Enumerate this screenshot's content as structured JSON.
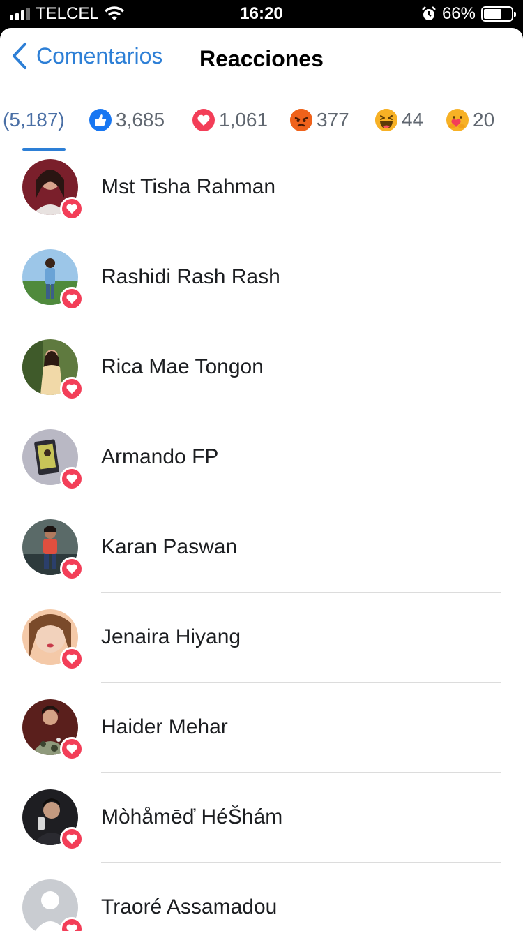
{
  "status_bar": {
    "carrier": "TELCEL",
    "time": "16:20",
    "battery": "66%",
    "battery_level": 0.66
  },
  "nav": {
    "back_label": "Comentarios",
    "title": "Reacciones"
  },
  "tabs": [
    {
      "label": "(5,187)",
      "icon": null
    },
    {
      "label": "3,685",
      "icon": "like-icon"
    },
    {
      "label": "1,061",
      "icon": "love-icon"
    },
    {
      "label": "377",
      "icon": "angry-icon"
    },
    {
      "label": "44",
      "icon": "haha-icon"
    },
    {
      "label": "20",
      "icon": "care-icon"
    }
  ],
  "users": [
    {
      "name": "Mst Tisha Rahman",
      "avatar": "avatar-photo",
      "reaction": "love-icon"
    },
    {
      "name": "Rashidi Rash Rash",
      "avatar": "avatar-photo",
      "reaction": "love-icon"
    },
    {
      "name": "Rica Mae Tongon",
      "avatar": "avatar-photo",
      "reaction": "love-icon"
    },
    {
      "name": "Armando FP",
      "avatar": "avatar-photo",
      "reaction": "love-icon"
    },
    {
      "name": "Karan Paswan",
      "avatar": "avatar-photo",
      "reaction": "love-icon"
    },
    {
      "name": "Jenaira Hiyang",
      "avatar": "avatar-photo",
      "reaction": "love-icon"
    },
    {
      "name": "Haider Mehar",
      "avatar": "avatar-photo",
      "reaction": "love-icon"
    },
    {
      "name": "Mòhåmēď HéŠhám",
      "avatar": "avatar-photo",
      "reaction": "love-icon"
    },
    {
      "name": "Traoré Assamadou",
      "avatar": "default-avatar-icon",
      "reaction": "love-icon"
    }
  ],
  "colors": {
    "accent": "#2d7fd6",
    "love": "#f33e58",
    "like": "#1877f2",
    "angry": "#e9710f",
    "haha": "#f7b125"
  }
}
